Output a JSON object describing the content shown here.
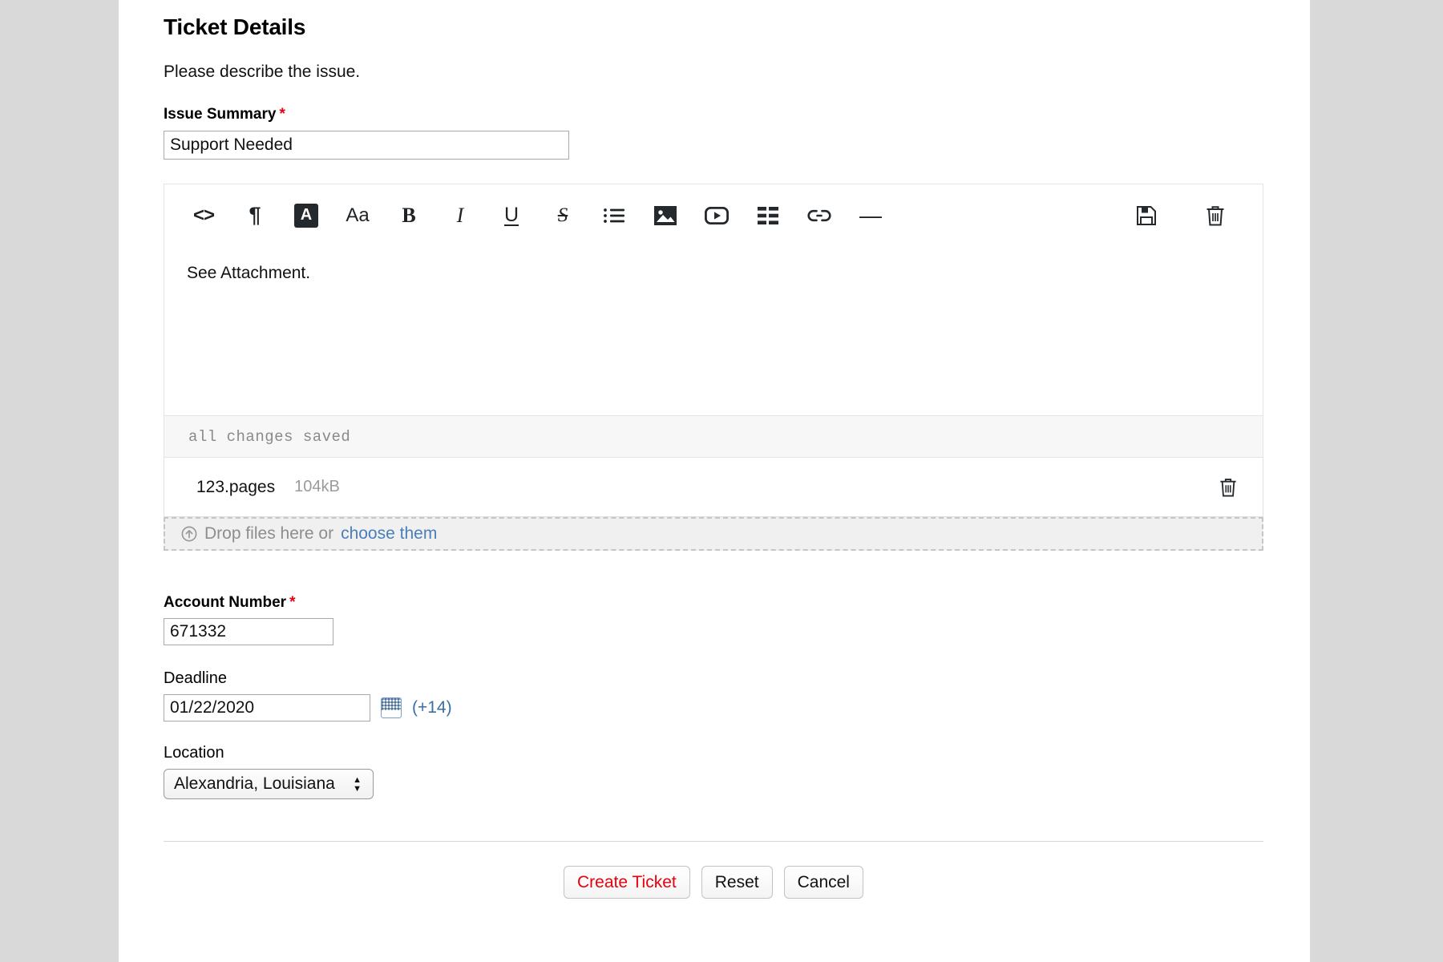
{
  "section": {
    "title": "Ticket Details",
    "subtitle": "Please describe the issue."
  },
  "fields": {
    "issue_summary": {
      "label": "Issue Summary",
      "required_marker": "*",
      "value": "Support Needed",
      "placeholder": ""
    },
    "account_number": {
      "label": "Account Number",
      "required_marker": "*",
      "value": "671332",
      "placeholder": ""
    },
    "deadline": {
      "label": "Deadline",
      "value": "01/22/2020",
      "placeholder": "",
      "offset_label": "(+14)",
      "calendar_icon": "calendar-icon"
    },
    "location": {
      "label": "Location",
      "value": "Alexandria, Louisiana",
      "options": [
        "Alexandria, Louisiana"
      ]
    }
  },
  "editor": {
    "content": "See Attachment.",
    "status": "all changes saved",
    "toolbar": [
      {
        "name": "code-icon",
        "label": "<>",
        "kind": "glyph-code"
      },
      {
        "name": "paragraph-icon",
        "label": "¶",
        "kind": "glyph-pilcrow"
      },
      {
        "name": "text-color-icon",
        "label": "A",
        "kind": "glyph-boxed"
      },
      {
        "name": "font-size-icon",
        "label": "Aa",
        "kind": "glyph-aa"
      },
      {
        "name": "bold-icon",
        "label": "B",
        "kind": "glyph-bold"
      },
      {
        "name": "italic-icon",
        "label": "I",
        "kind": "glyph-italic"
      },
      {
        "name": "underline-icon",
        "label": "U",
        "kind": "glyph-underline"
      },
      {
        "name": "strikethrough-icon",
        "label": "S",
        "kind": "glyph-strike"
      },
      {
        "name": "bullet-list-icon",
        "label": "",
        "kind": "svg-list"
      },
      {
        "name": "image-icon",
        "label": "",
        "kind": "svg-image"
      },
      {
        "name": "video-icon",
        "label": "",
        "kind": "svg-video"
      },
      {
        "name": "table-icon",
        "label": "",
        "kind": "svg-table"
      },
      {
        "name": "link-icon",
        "label": "",
        "kind": "svg-link"
      },
      {
        "name": "horizontal-rule-icon",
        "label": "—",
        "kind": "glyph-hr"
      }
    ],
    "toolbar_right": [
      {
        "name": "save-icon",
        "kind": "svg-save"
      },
      {
        "name": "delete-icon",
        "kind": "svg-trash"
      }
    ]
  },
  "attachments": {
    "files": [
      {
        "name": "123.pages",
        "size": "104kB",
        "delete_icon": "trash-icon"
      }
    ],
    "dropzone": {
      "icon": "upload-circle-icon",
      "text": "Drop files here or",
      "link": "choose them"
    }
  },
  "footer": {
    "buttons": [
      {
        "name": "create-ticket-button",
        "label": "Create Ticket",
        "style": "primary"
      },
      {
        "name": "reset-button",
        "label": "Reset",
        "style": "default"
      },
      {
        "name": "cancel-button",
        "label": "Cancel",
        "style": "default"
      }
    ]
  },
  "colors": {
    "required_red": "#e8000d",
    "primary_action": "#e8000d",
    "link_blue": "#4a7ebb",
    "page_background": "#d9d9d9",
    "panel_background": "#ffffff"
  }
}
